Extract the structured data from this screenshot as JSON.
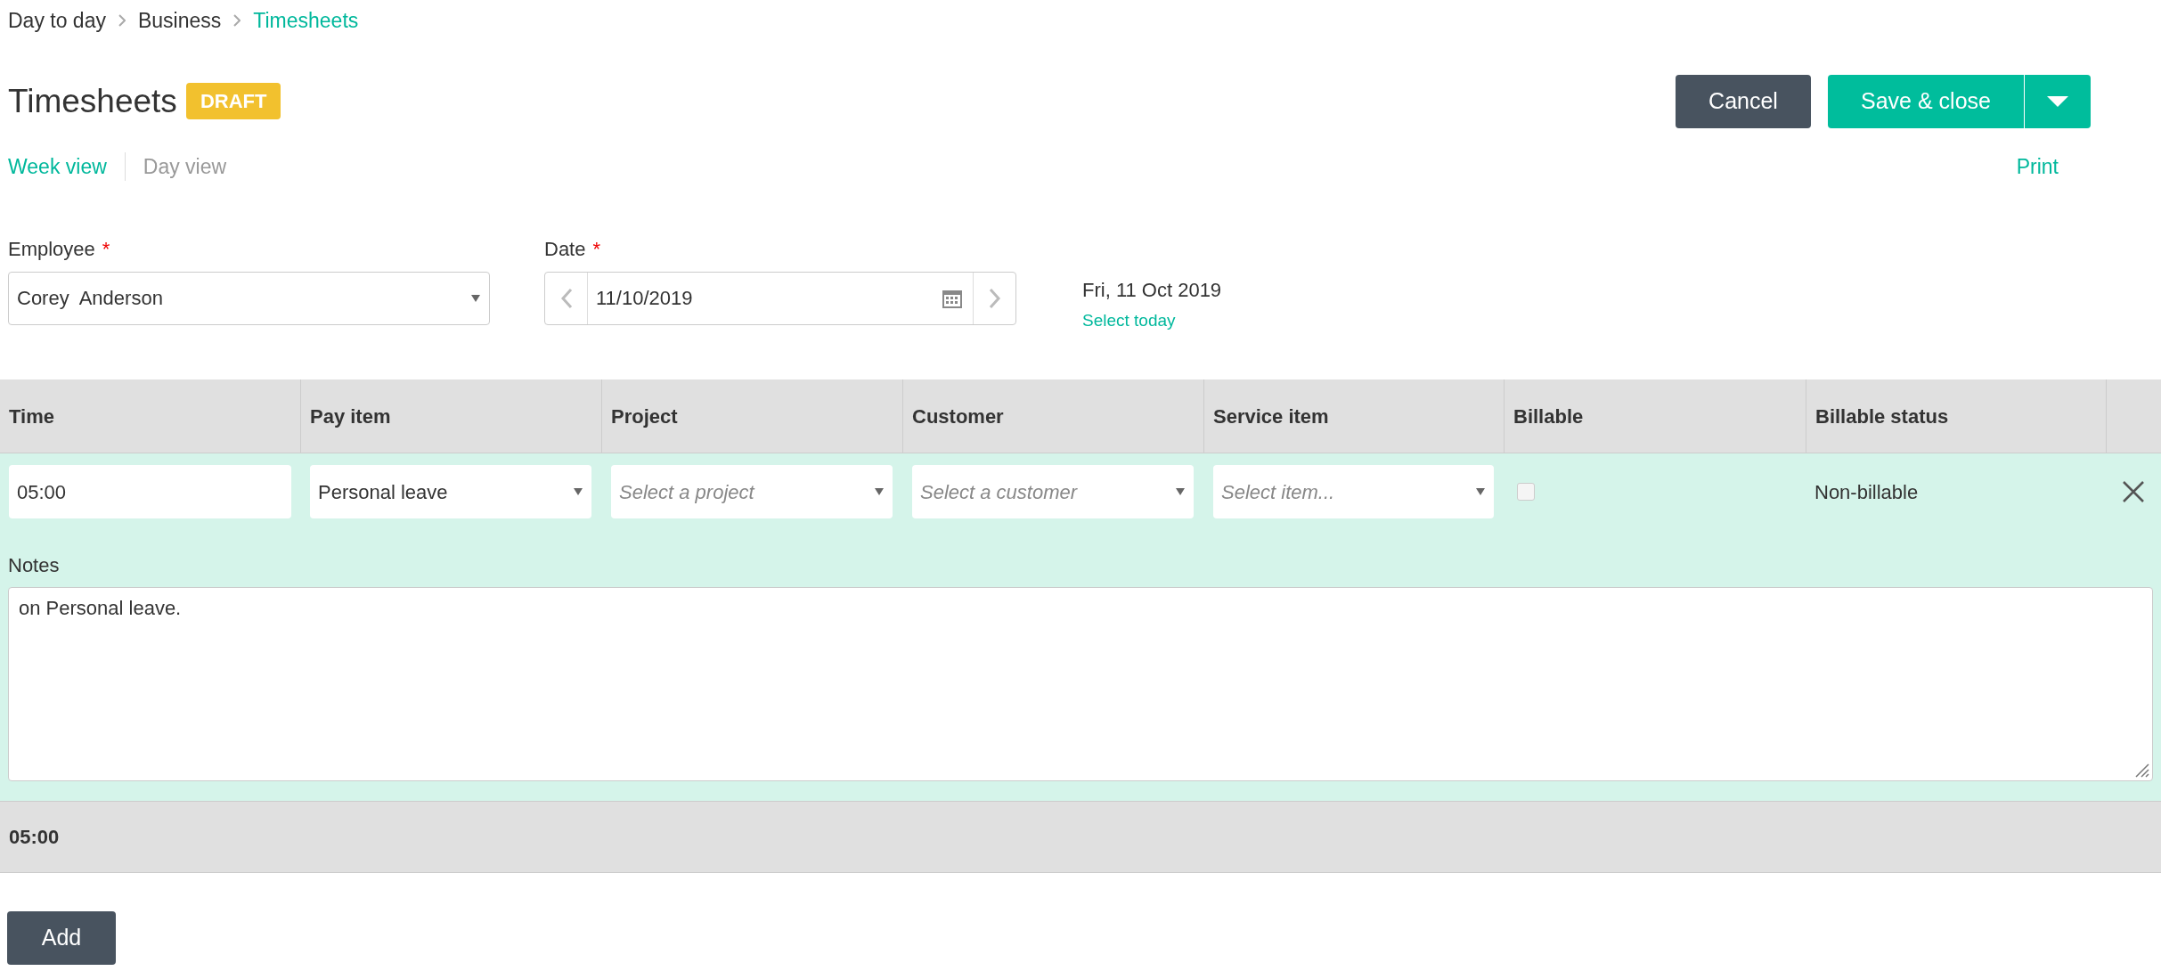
{
  "breadcrumb": [
    {
      "label": "Day to day",
      "current": false
    },
    {
      "label": "Business",
      "current": false
    },
    {
      "label": "Timesheets",
      "current": true
    }
  ],
  "title": "Timesheets",
  "status_badge": "DRAFT",
  "actions": {
    "cancel": "Cancel",
    "save": "Save & close"
  },
  "views": [
    {
      "label": "Week view",
      "selected": true
    },
    {
      "label": "Day view",
      "selected": false
    }
  ],
  "print": "Print",
  "employee": {
    "label": "Employee",
    "required_mark": "*",
    "value": "Corey  Anderson"
  },
  "date": {
    "label": "Date",
    "required_mark": "*",
    "value": "11/10/2019"
  },
  "date_long": "Fri, 11 Oct 2019",
  "select_today": "Select today",
  "table": {
    "columns": [
      "Time",
      "Pay item",
      "Project",
      "Customer",
      "Service item",
      "Billable",
      "Billable status"
    ],
    "rows": [
      {
        "time": "05:00",
        "pay_item": "Personal leave",
        "project": {
          "placeholder": "Select a project"
        },
        "customer": {
          "placeholder": "Select a customer"
        },
        "service_item": {
          "placeholder": "Select item..."
        },
        "billable": false,
        "billable_status": "Non-billable",
        "notes_label": "Notes",
        "notes": "on Personal leave."
      }
    ],
    "total": "05:00"
  },
  "add": "Add"
}
